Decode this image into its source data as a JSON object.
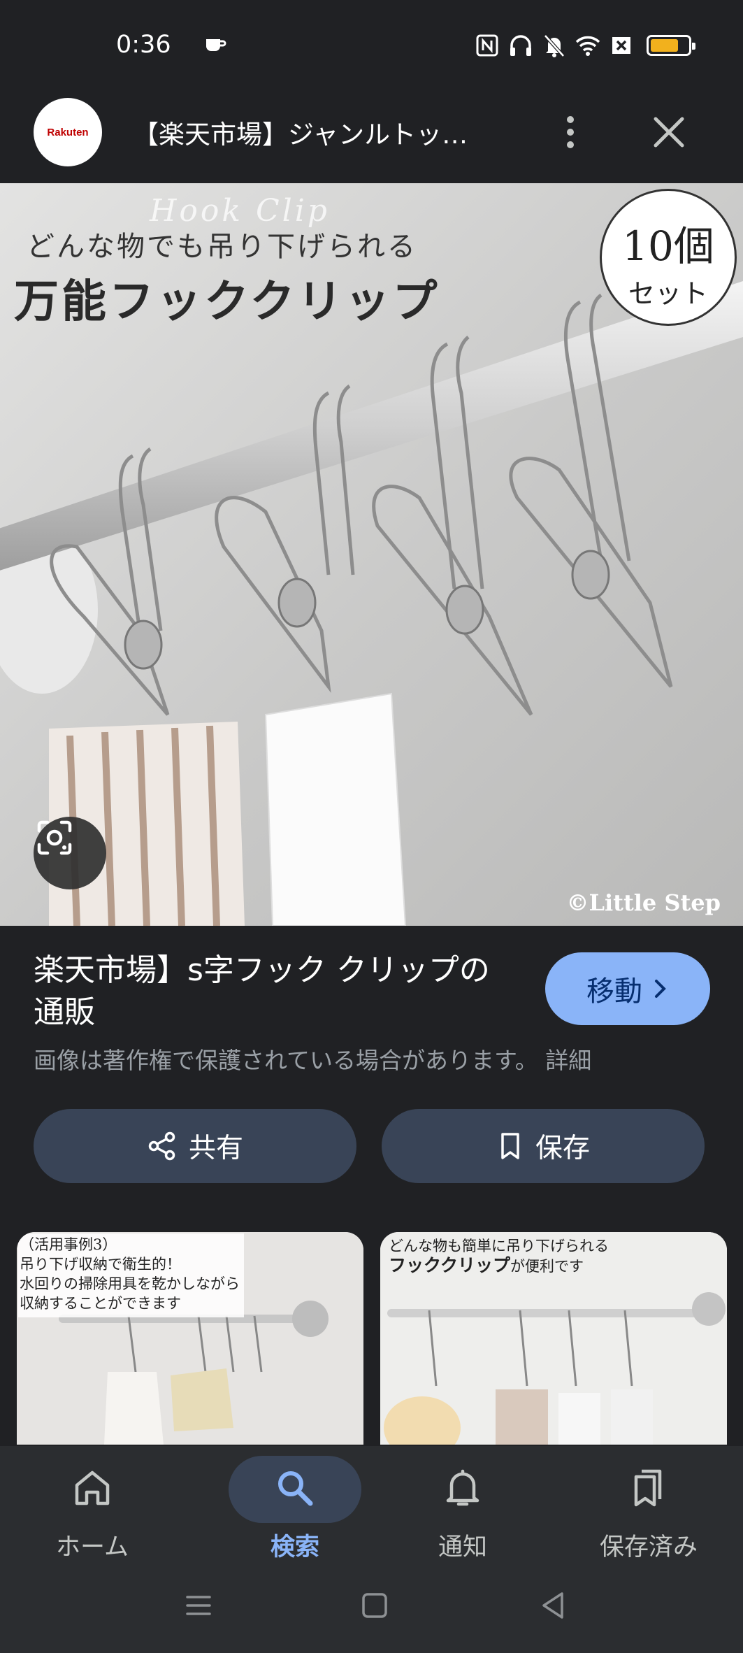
{
  "status_bar": {
    "time": "0:36",
    "icons": [
      "coffee-icon",
      "nfc-icon",
      "headphones-icon",
      "bell-off-icon",
      "wifi-icon",
      "sim-off-icon",
      "battery-icon"
    ],
    "battery_level": 0.75,
    "battery_color": "#f2b11d"
  },
  "header": {
    "site_logo_text": "Rakuten",
    "page_title": "【楽天市場】ジャンルトッ…",
    "more_icon": "more-vert-icon",
    "close_icon": "close-icon"
  },
  "image": {
    "watermark": "Hook Clip",
    "tagline": "どんな物でも吊り下げられる",
    "headline": "万能フッククリップ",
    "badge_count": "10個",
    "badge_set": "セット",
    "copyright": "©Little Step",
    "lens_icon": "lens-icon"
  },
  "result": {
    "title": "楽天市場】s字フック クリップの通販",
    "visit_label": "移動",
    "copyright_notice": "画像は著作権で保護されている場合があります。 詳細"
  },
  "actions": {
    "share_label": "共有",
    "save_label": "保存"
  },
  "related": [
    {
      "caption_lines": [
        "（活用事例3）",
        "吊り下げ収納で衛生的！",
        "水回りの掃除用具を乾かしながら",
        "収納することができます"
      ]
    },
    {
      "caption_line1": "どんな物も簡単に吊り下げられる",
      "caption_bold": "フッククリップ",
      "caption_tail": "が便利です"
    }
  ],
  "bottom_nav": {
    "items": [
      {
        "label": "ホーム",
        "icon": "home-icon"
      },
      {
        "label": "検索",
        "icon": "search-icon",
        "active": true
      },
      {
        "label": "通知",
        "icon": "bell-icon"
      },
      {
        "label": "保存済み",
        "icon": "bookmarks-icon"
      }
    ],
    "active_color": "#8ab4f8"
  }
}
